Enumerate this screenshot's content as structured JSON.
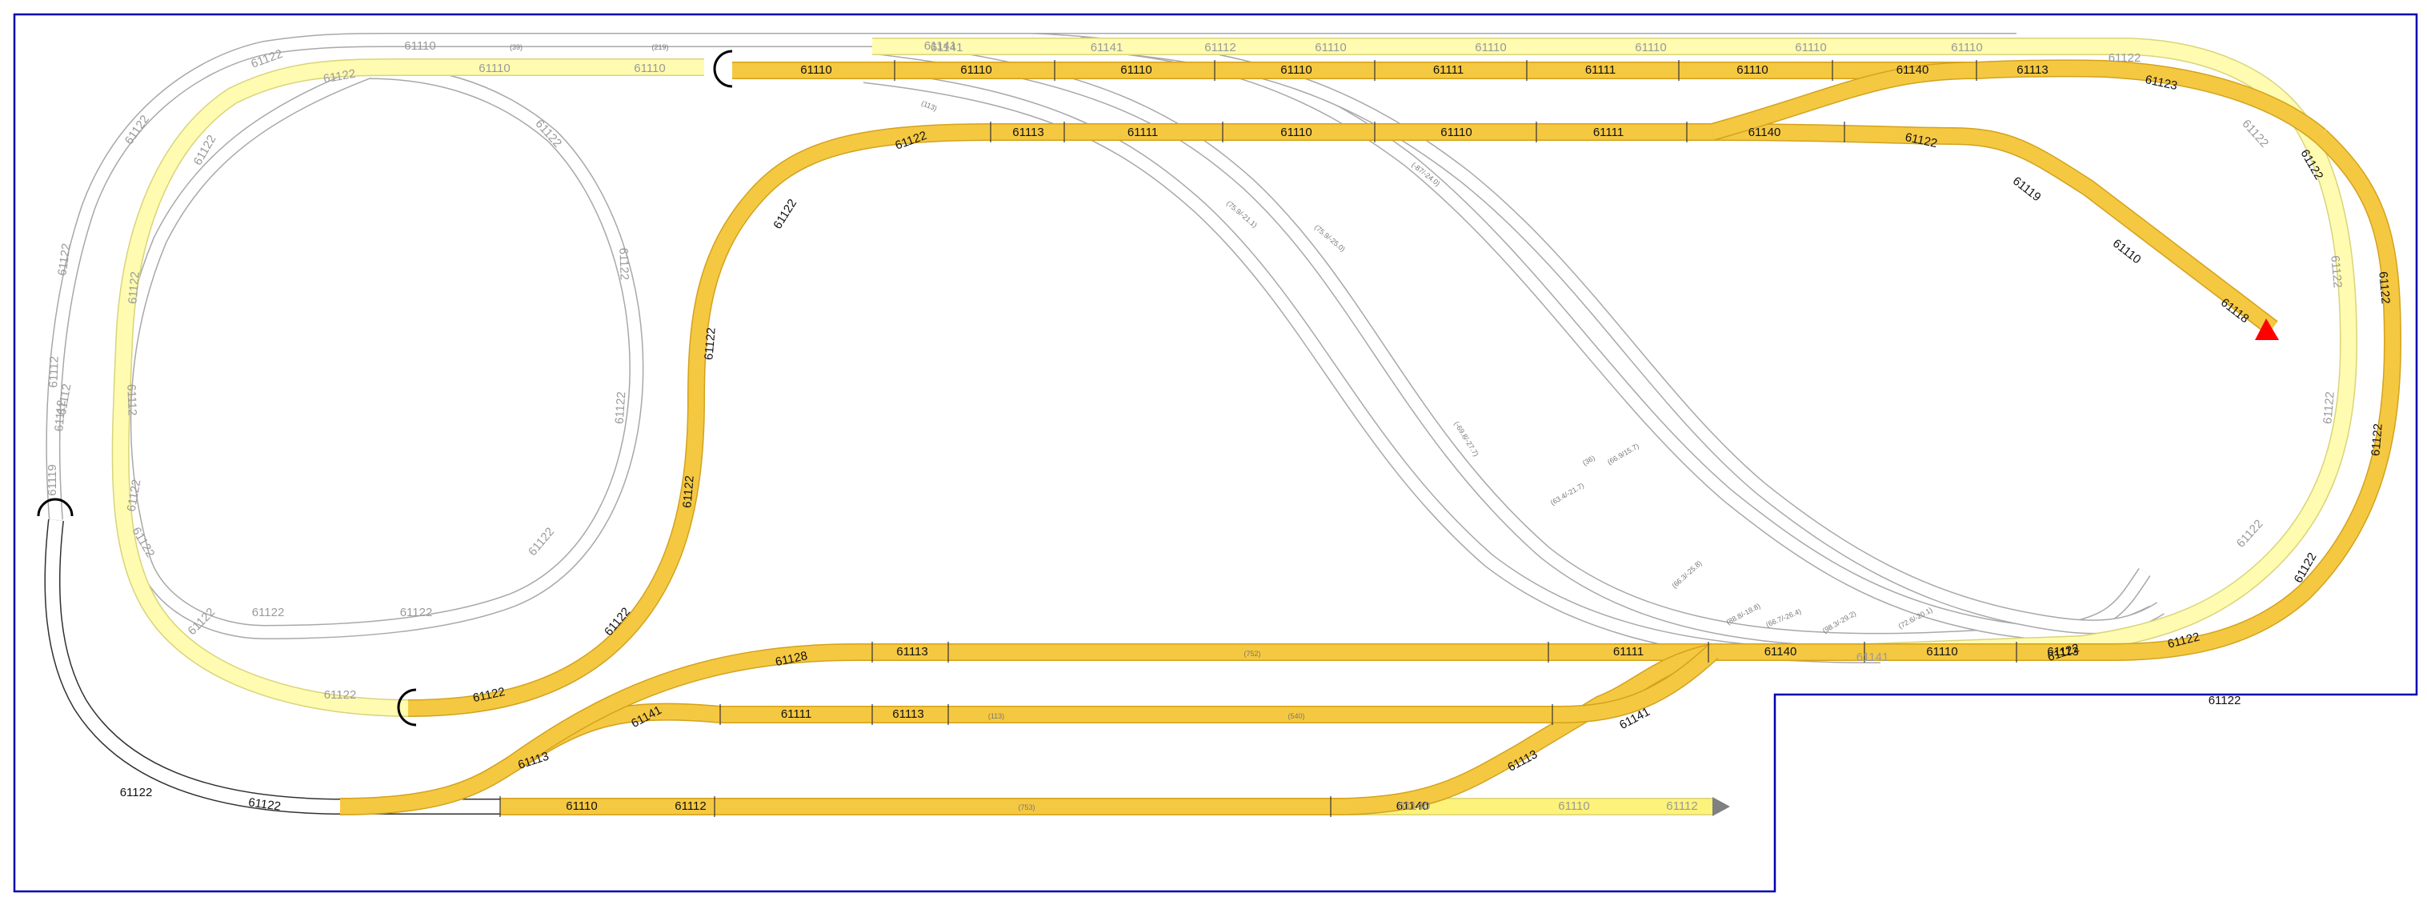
{
  "plan": {
    "baseboard_color": "#0000b0",
    "track_colors": {
      "main": "#f5c842",
      "main_edge": "#d4a21c",
      "pale": "#fffbb0",
      "hidden": "#a8a8a8",
      "lower": "#303030"
    },
    "end_marker_colors": {
      "red": "#ff0000",
      "grey": "#808080"
    }
  },
  "labels_main": [
    "61110",
    "61110",
    "61110",
    "61110",
    "61111",
    "61111",
    "61110",
    "61140",
    "61113",
    "61123",
    "61113",
    "61111",
    "61110",
    "61110",
    "61111",
    "61140",
    "61122",
    "61119",
    "61110",
    "61118",
    "61122",
    "61122",
    "61122",
    "61122",
    "61122",
    "61122",
    "61122",
    "61122",
    "61122",
    "61122",
    "61122",
    "61128",
    "61113",
    "61111",
    "61140",
    "61110",
    "61113",
    "61122",
    "61141",
    "61111",
    "61113",
    "61141",
    "61113",
    "61113",
    "61110",
    "61112",
    "61140",
    "61122",
    "61122",
    "61122"
  ],
  "labels_pale": [
    "61110",
    "61110",
    "61122",
    "61122",
    "61122",
    "61112",
    "61122",
    "61122",
    "61122",
    "61141",
    "61141",
    "61112",
    "61110",
    "61110",
    "61110",
    "61110",
    "61110",
    "61122",
    "61122",
    "61122",
    "61122",
    "61122",
    "61140",
    "61110",
    "61112",
    "61141"
  ],
  "labels_hidden": [
    "61122",
    "61110",
    "61122",
    "61122",
    "61112",
    "61112",
    "61122",
    "61122",
    "61122",
    "61122",
    "61122",
    "61122",
    "61122",
    "61112",
    "61119",
    "61141"
  ],
  "labels_small": [
    "(39)",
    "(219)",
    "(113)",
    "(752)",
    "(113)",
    "(540)",
    "(753)",
    "(75.9/-21.1)",
    "(75.9/-25.0)",
    "(-87/-24.0)",
    "(66.9/15.7)",
    "(66.3/-25.8)",
    "(88.8/-18.8)",
    "(-69.8/-27.7)",
    "(63.4/-21.7)",
    "(66.7/-26.4)",
    "(72.6/-20.1)",
    "(36)",
    "(98.3/-29.2)"
  ]
}
